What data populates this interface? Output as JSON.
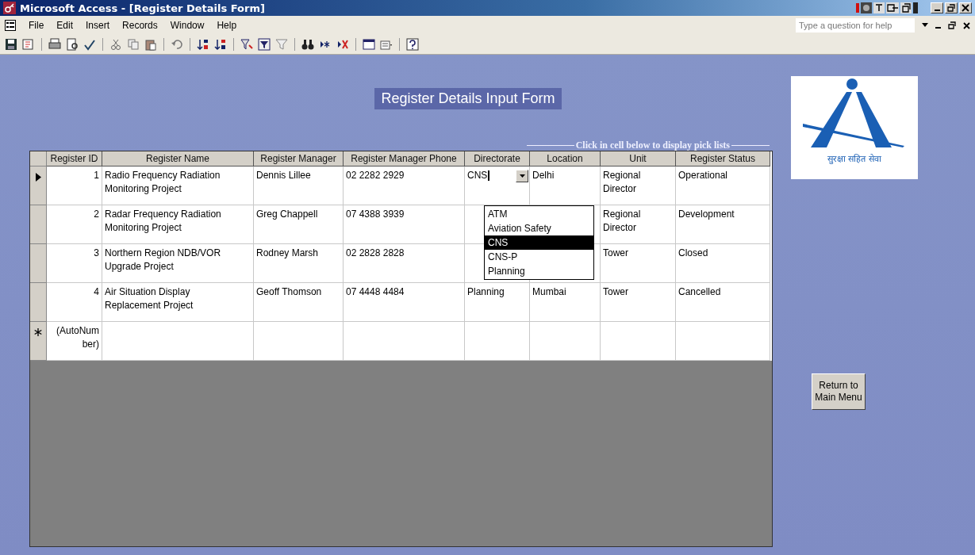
{
  "window": {
    "title": "Microsoft Access - [Register Details Form]"
  },
  "menu": [
    "File",
    "Edit",
    "Insert",
    "Records",
    "Window",
    "Help"
  ],
  "help_box": {
    "placeholder": "Type a question for help"
  },
  "form": {
    "title": "Register Details Input Form",
    "hint": "Click in cell below to display pick lists",
    "columns": [
      "Register ID",
      "Register Name",
      "Register Manager",
      "Register Manager Phone",
      "Directorate",
      "Location",
      "Unit",
      "Register Status"
    ],
    "rows": [
      {
        "selected": true,
        "id": "1",
        "name": "Radio Frequency Radiation Monitoring Project",
        "manager": "Dennis Lillee",
        "phone": "02 2282 2929",
        "directorate": "CNS",
        "location": "Delhi",
        "unit": "Regional Director",
        "status": "Operational"
      },
      {
        "selected": false,
        "id": "2",
        "name": "Radar Frequency Radiation Monitoring Project",
        "manager": "Greg Chappell",
        "phone": "07 4388 3939",
        "unit": "Regional Director",
        "status": "Development"
      },
      {
        "selected": false,
        "id": "3",
        "name": "Northern Region NDB/VOR Upgrade Project",
        "manager": "Rodney Marsh",
        "phone": "02 2828 2828",
        "unit": "Tower",
        "status": "Closed"
      },
      {
        "selected": false,
        "id": "4",
        "name": "Air Situation Display Replacement Project",
        "manager": "Geoff Thomson",
        "phone": "07 4448 4484",
        "directorate": "Planning",
        "location": "Mumbai",
        "unit": "Tower",
        "status": "Cancelled"
      }
    ],
    "new_row": {
      "id": "(AutoNumber)"
    },
    "pick_list": [
      {
        "label": "ATM",
        "selected": false
      },
      {
        "label": "Aviation Safety",
        "selected": false
      },
      {
        "label": "CNS",
        "selected": true
      },
      {
        "label": "CNS-P",
        "selected": false
      },
      {
        "label": "Planning",
        "selected": false
      }
    ]
  },
  "logo": {
    "tagline": "सुरक्षा सहित सेवा"
  },
  "return_button": "Return to Main Menu"
}
